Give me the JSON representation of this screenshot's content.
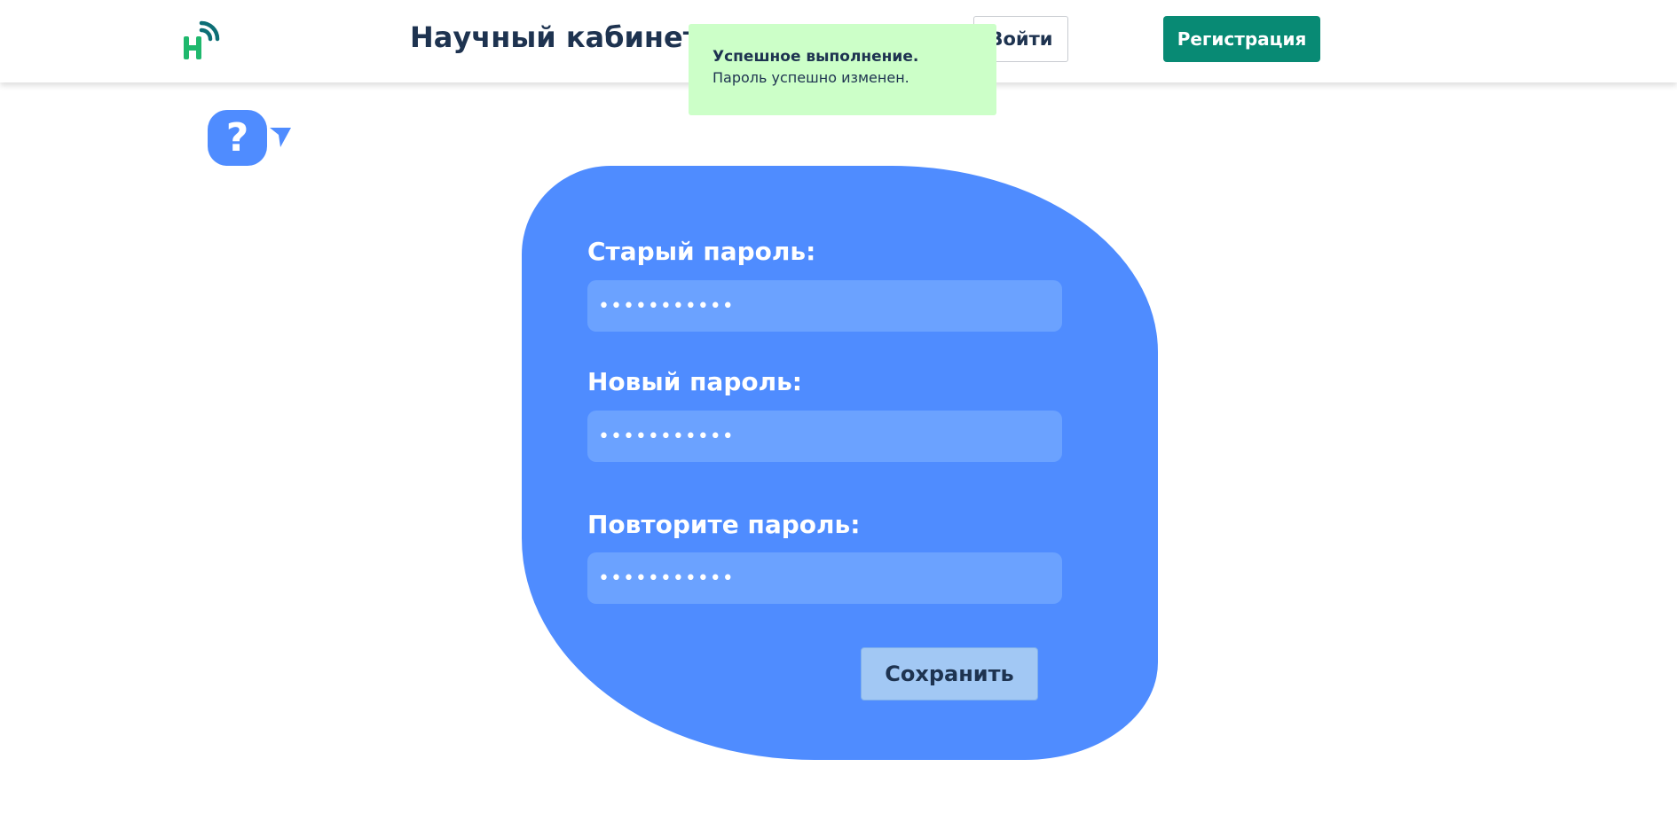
{
  "header": {
    "title": "Научный кабинет",
    "login_label": "Войти",
    "register_label": "Регистрация"
  },
  "toast": {
    "title": "Успешное выполнение.",
    "message": "Пароль успешно изменен."
  },
  "help": {
    "icon_char": "?"
  },
  "form": {
    "old_password": {
      "label": "Старый пароль:",
      "value": "•••••••••••"
    },
    "new_password": {
      "label": "Новый пароль:",
      "value": "•••••••••••"
    },
    "repeat_password": {
      "label": "Повторите пароль:",
      "value": "•••••••••••"
    },
    "save_label": "Сохранить"
  },
  "colors": {
    "brand_green": "#088a74",
    "logo_green": "#1fb86d",
    "logo_teal": "#0d6e75",
    "form_blue": "#4f8cff",
    "input_blue": "#6ba2ff",
    "toast_bg": "#ccffc8",
    "text_dark": "#1e3350"
  }
}
